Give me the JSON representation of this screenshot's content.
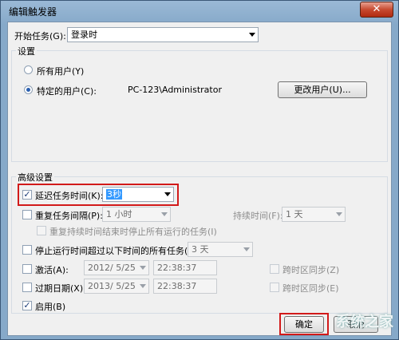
{
  "window": {
    "title": "编辑触发器",
    "close_glyph": "✕"
  },
  "start_task": {
    "label": "开始任务(G):",
    "value": "登录时"
  },
  "settings": {
    "group_label": "设置",
    "all_users": "所有用户(Y)",
    "specific_user": "特定的用户(C):",
    "user_name": "PC-123\\Administrator",
    "change_user_button": "更改用户(U)..."
  },
  "advanced": {
    "group_label": "高级设置",
    "delay": {
      "label": "延迟任务时间(K):",
      "value": "3秒",
      "checked": true
    },
    "repeat": {
      "label": "重复任务间隔(P):",
      "value": "1 小时",
      "duration_label": "持续时间(F):",
      "duration_value": "1 天"
    },
    "stop_repeat": "重复持续时间结束时停止所有运行的任务(I)",
    "stop_longer": {
      "label": "停止运行时间超过以下时间的所有任务(L):",
      "value": "3 天"
    },
    "activate": {
      "label": "激活(A):",
      "date": "2012/ 5/25",
      "time": "22:38:37",
      "sync": "跨时区同步(Z)"
    },
    "expire": {
      "label": "过期日期(X):",
      "date": "2013/ 5/25",
      "time": "22:38:37",
      "sync": "跨时区同步(E)"
    },
    "enabled": {
      "label": "启用(B)",
      "checked": true
    }
  },
  "buttons": {
    "ok": "确定",
    "cancel": "取消"
  },
  "watermark": "系统之家",
  "colors": {
    "highlight": "#d21a1a",
    "selection": "#3399ff"
  }
}
